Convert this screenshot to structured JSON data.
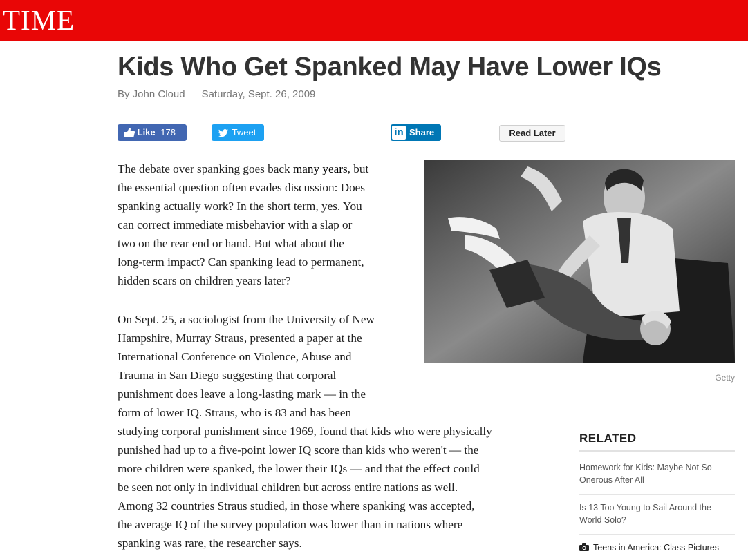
{
  "masthead": {
    "logo": "TIME",
    "color": "#e90606"
  },
  "article": {
    "headline": "Kids Who Get Spanked May Have Lower IQs",
    "author": "By John Cloud",
    "date": "Saturday, Sept. 26, 2009",
    "paragraph1": [
      {
        "pre": "The debate over spanking goes back ",
        "link": "many years",
        "post": ", but"
      },
      {
        "text": "the essential question often evades discussion: Does"
      },
      {
        "text": "spanking actually work? In the short term, yes. You"
      },
      {
        "text": "can correct immediate misbehavior with a slap or"
      },
      {
        "text": "two on the rear end or hand. But what about the"
      },
      {
        "text": "long-term impact? Can spanking lead to permanent,"
      },
      {
        "text": "hidden scars on children years later?"
      }
    ],
    "paragraph2": [
      "On Sept. 25, a sociologist from the University of New",
      "Hampshire, Murray Straus, presented a paper at the",
      "International Conference on Violence, Abuse and",
      "Trauma in San Diego suggesting that corporal",
      "punishment does leave a long-lasting mark — in the",
      "form of lower IQ. Straus, who is 83 and has been"
    ],
    "paragraph3": [
      "studying corporal punishment since 1969, found that kids who were physically",
      "punished had up to a five-point lower IQ score than kids who weren't — the",
      "more children were spanked, the lower their IQs — and that the effect could",
      "be seen not only in individual children but across entire nations as well.",
      "Among 32 countries Straus studied, in those where spanking was accepted,",
      "the average IQ of the survey population was lower than in nations where",
      "spanking was rare, the researcher says."
    ],
    "image_credit": "Getty"
  },
  "social": {
    "like_label": "Like",
    "like_count": "178",
    "tweet_label": "Tweet",
    "share_label": "Share",
    "linkedin_glyph": "in",
    "read_later_label": "Read Later"
  },
  "related": {
    "title": "RELATED",
    "items": [
      {
        "label": "Homework for Kids: Maybe Not So Onerous After All"
      },
      {
        "label": "Is 13 Too Young to Sail Around the World Solo?"
      },
      {
        "label": "Teens in America: Class Pictures",
        "icon": "camera-icon"
      }
    ]
  }
}
